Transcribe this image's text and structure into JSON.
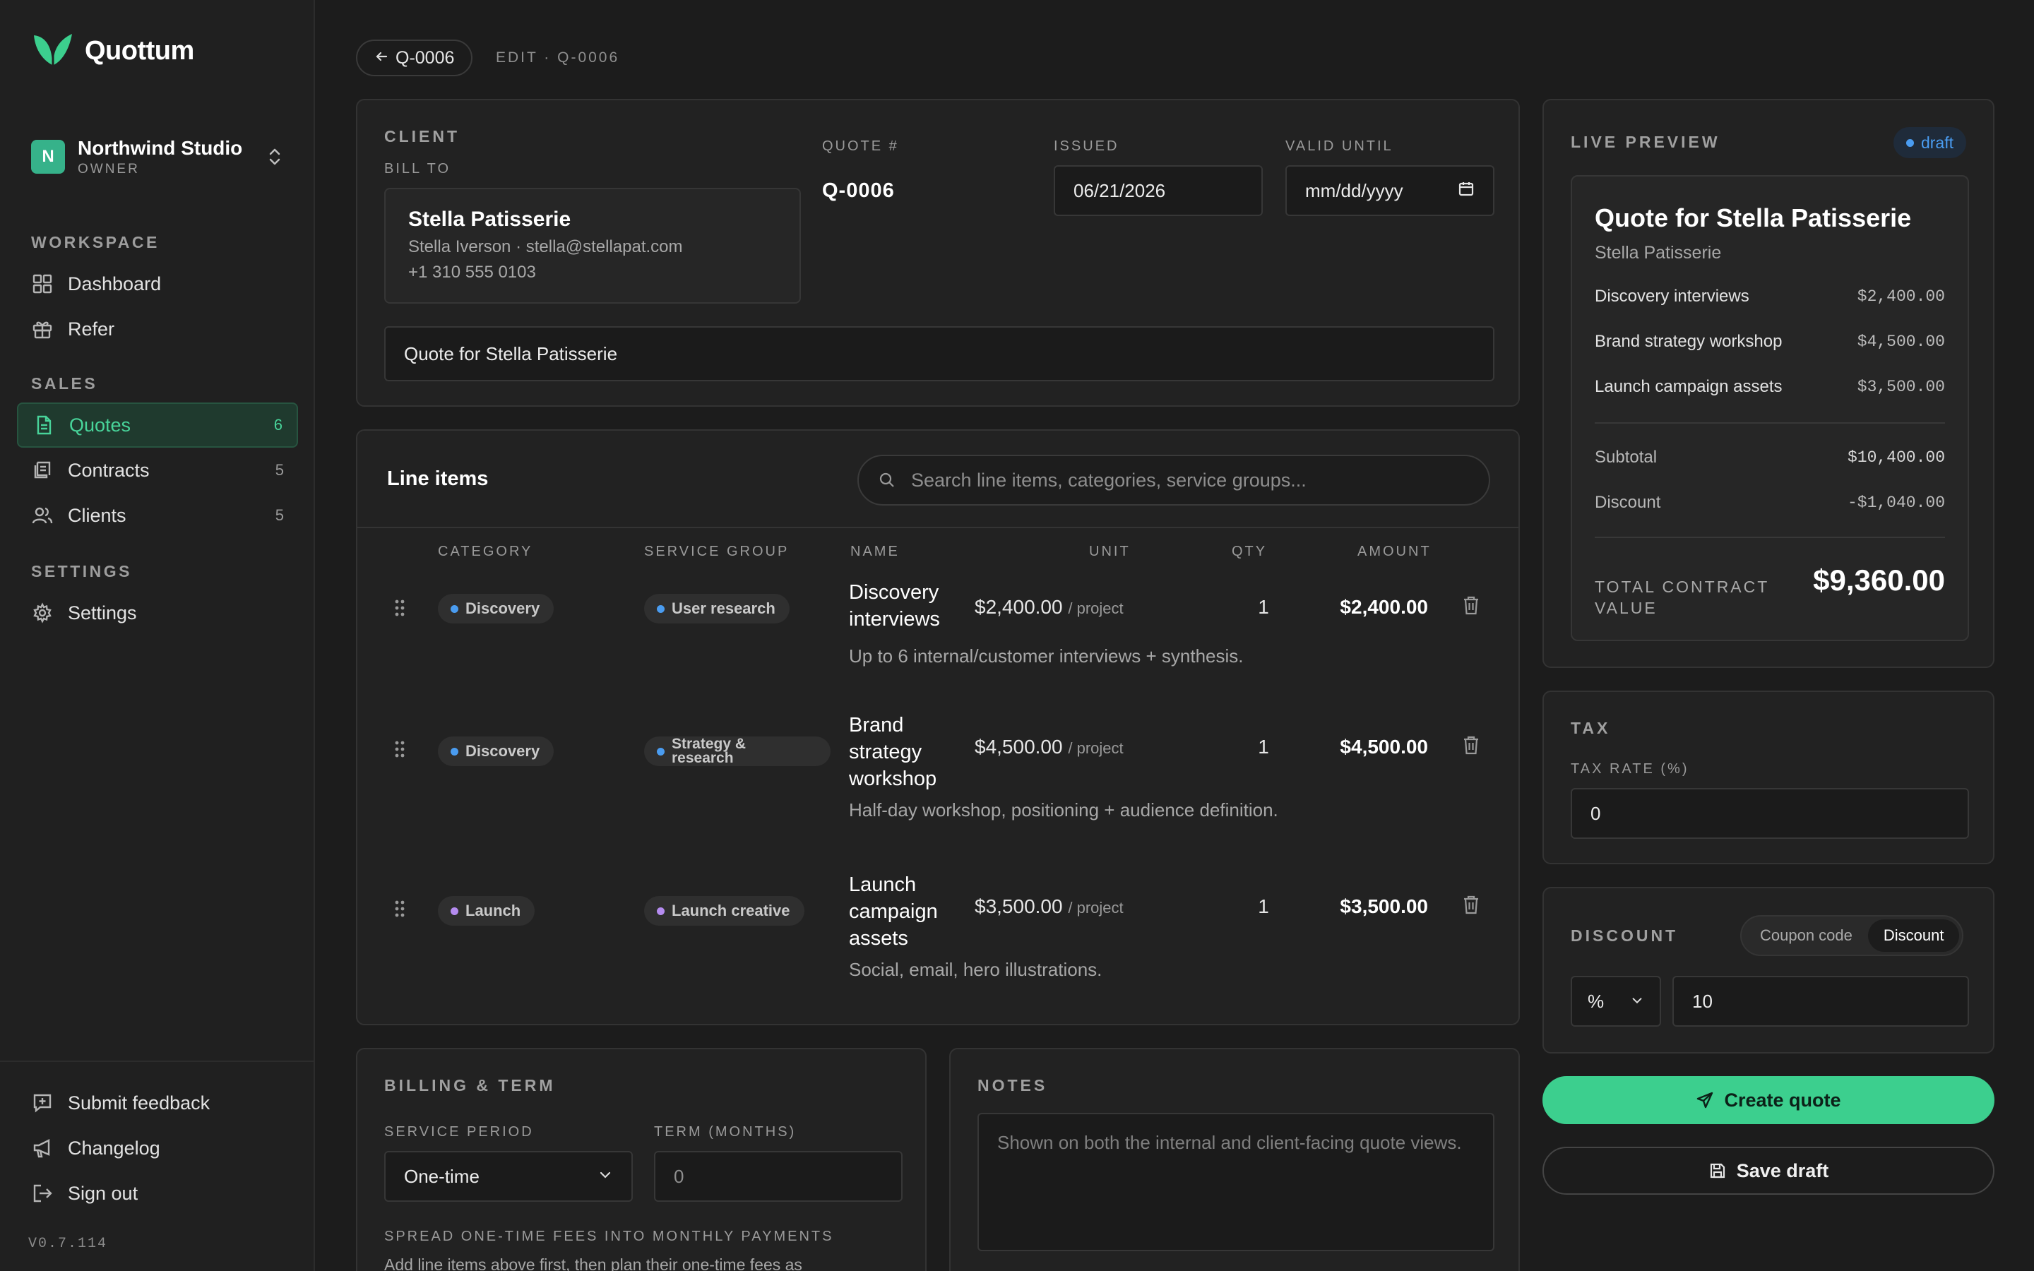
{
  "brand": {
    "name": "Quottum",
    "accent": "#3ccf8e"
  },
  "org": {
    "initial": "N",
    "name": "Northwind Studio",
    "role": "OWNER"
  },
  "nav": {
    "workspace_label": "WORKSPACE",
    "dashboard": "Dashboard",
    "refer": "Refer",
    "sales_label": "SALES",
    "quotes": {
      "label": "Quotes",
      "count": "6"
    },
    "contracts": {
      "label": "Contracts",
      "count": "5"
    },
    "clients": {
      "label": "Clients",
      "count": "5"
    },
    "settings_label": "SETTINGS",
    "settings": "Settings",
    "feedback": "Submit feedback",
    "changelog": "Changelog",
    "signout": "Sign out",
    "version": "V0.7.114"
  },
  "header": {
    "back_label": "Q-0006",
    "crumb": "EDIT · Q-0006"
  },
  "client": {
    "section_label": "CLIENT",
    "bill_to_label": "BILL TO",
    "name": "Stella Patisserie",
    "contact": "Stella Iverson · stella@stellapat.com",
    "phone": "+1 310 555 0103",
    "quote_no_label": "QUOTE #",
    "quote_no": "Q-0006",
    "issued_label": "ISSUED",
    "issued_value": "06/21/2026",
    "valid_label": "VALID UNTIL",
    "valid_placeholder": "mm/dd/yyyy",
    "title_value": "Quote for Stella Patisserie"
  },
  "line_items": {
    "title": "Line items",
    "search_placeholder": "Search line items, categories, service groups...",
    "columns": {
      "category": "CATEGORY",
      "service_group": "SERVICE GROUP",
      "name": "NAME",
      "unit": "UNIT",
      "qty": "QTY",
      "amount": "AMOUNT"
    },
    "rows": [
      {
        "category": "Discovery",
        "category_color": "#4a9cf0",
        "group": "User research",
        "group_color": "#4a9cf0",
        "name": "Discovery interviews",
        "unit": "$2,400.00",
        "per": "/ project",
        "qty": "1",
        "amount": "$2,400.00",
        "desc": "Up to 6 internal/customer interviews + synthesis."
      },
      {
        "category": "Discovery",
        "category_color": "#4a9cf0",
        "group": "Strategy & research",
        "group_color": "#4a9cf0",
        "name": "Brand strategy workshop",
        "unit": "$4,500.00",
        "per": "/ project",
        "qty": "1",
        "amount": "$4,500.00",
        "desc": "Half-day workshop, positioning + audience definition."
      },
      {
        "category": "Launch",
        "category_color": "#b58cf0",
        "group": "Launch creative",
        "group_color": "#b58cf0",
        "name": "Launch campaign assets",
        "unit": "$3,500.00",
        "per": "/ project",
        "qty": "1",
        "amount": "$3,500.00",
        "desc": "Social, email, hero illustrations."
      }
    ]
  },
  "billing": {
    "section_label": "BILLING & TERM",
    "period_label": "SERVICE PERIOD",
    "period_value": "One-time",
    "term_label": "TERM (MONTHS)",
    "term_placeholder": "0",
    "spread_label": "SPREAD ONE-TIME FEES INTO MONTHLY PAYMENTS",
    "spread_help": "Add line items above first, then plan their one-time fees as"
  },
  "notes": {
    "section_label": "NOTES",
    "placeholder": "Shown on both the internal and client-facing quote views."
  },
  "preview": {
    "section_label": "LIVE PREVIEW",
    "badge": "draft",
    "badge_color": "#4a9cf0",
    "title": "Quote for Stella Patisserie",
    "client": "Stella Patisserie",
    "items": [
      {
        "name": "Discovery interviews",
        "amount": "$2,400.00"
      },
      {
        "name": "Brand strategy workshop",
        "amount": "$4,500.00"
      },
      {
        "name": "Launch campaign assets",
        "amount": "$3,500.00"
      }
    ],
    "subtotal_label": "Subtotal",
    "subtotal": "$10,400.00",
    "discount_label": "Discount",
    "discount": "-$1,040.00",
    "total_label": "TOTAL CONTRACT VALUE",
    "total": "$9,360.00"
  },
  "tax": {
    "section_label": "TAX",
    "rate_label": "TAX RATE (%)",
    "rate_value": "0"
  },
  "discount": {
    "section_label": "DISCOUNT",
    "opt_coupon": "Coupon code",
    "opt_discount": "Discount",
    "type_value": "%",
    "amount_value": "10"
  },
  "actions": {
    "create": "Create quote",
    "save": "Save draft"
  }
}
